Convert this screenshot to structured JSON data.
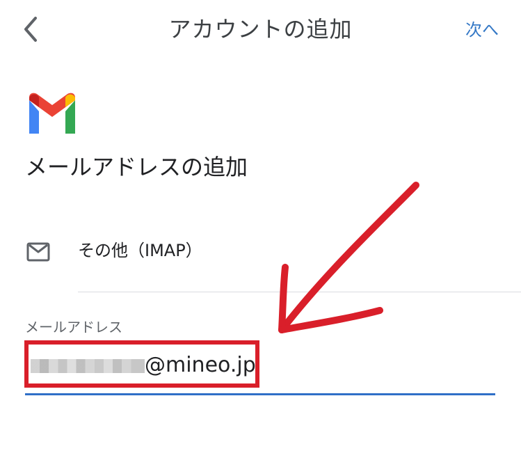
{
  "header": {
    "title": "アカウントの追加",
    "next_label": "次へ"
  },
  "icons": {
    "back": "chevron-left-icon",
    "brand": "gmail-logo-icon",
    "provider": "mail-icon"
  },
  "content": {
    "heading": "メールアドレスの追加"
  },
  "provider": {
    "label": "その他（IMAP）"
  },
  "email_input": {
    "label": "メールアドレス",
    "value_suffix": "@mineo.jp"
  },
  "colors": {
    "accent": "#3478c6",
    "underline": "#2f6fc7",
    "annotation_red": "#d91f2a",
    "gmail_blue": "#4285f4",
    "gmail_red": "#ea4335",
    "gmail_yellow": "#fbbc04",
    "gmail_green": "#34a853"
  }
}
